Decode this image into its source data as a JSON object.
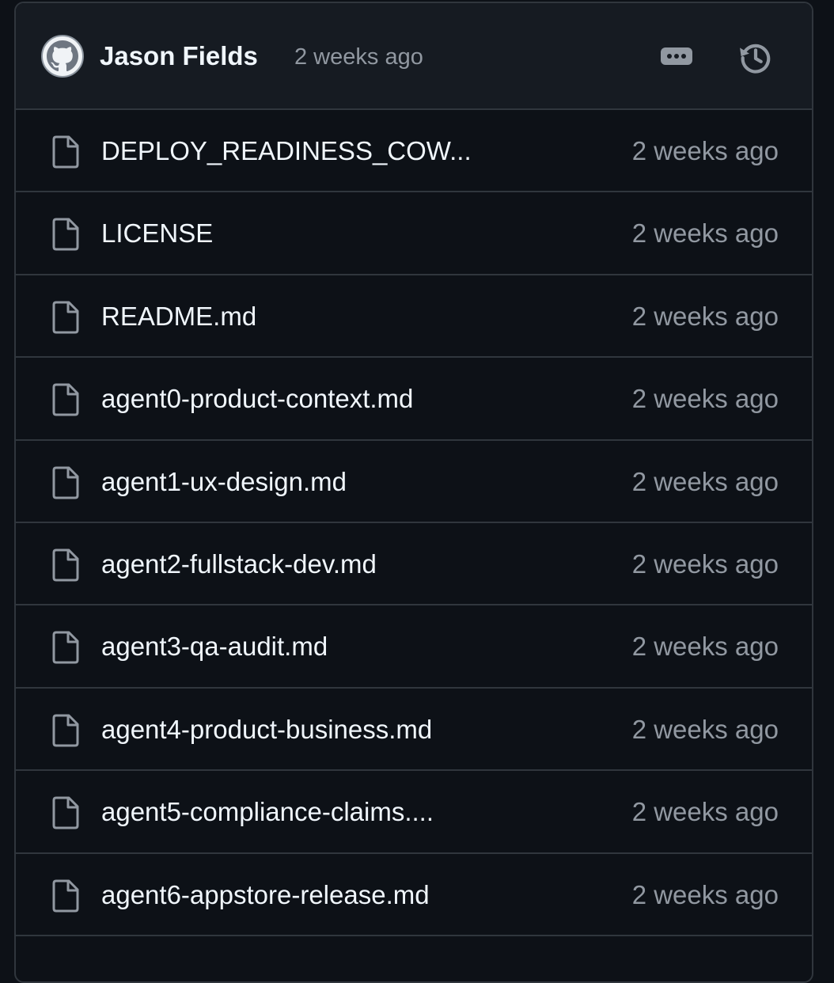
{
  "commit": {
    "author": "Jason Fields",
    "time": "2 weeks ago"
  },
  "icons": {
    "avatar": "github-octocat-icon",
    "more": "kebab-horizontal-icon",
    "history": "history-icon",
    "file": "file-icon"
  },
  "colors": {
    "background": "#0d1117",
    "header": "#161b22",
    "border": "#30363d",
    "text": "#f0f6fc",
    "muted": "#9198a1"
  },
  "files": [
    {
      "name": "DEPLOY_READINESS_COW...",
      "time": "2 weeks ago"
    },
    {
      "name": "LICENSE",
      "time": "2 weeks ago"
    },
    {
      "name": "README.md",
      "time": "2 weeks ago"
    },
    {
      "name": "agent0-product-context.md",
      "time": "2 weeks ago"
    },
    {
      "name": "agent1-ux-design.md",
      "time": "2 weeks ago"
    },
    {
      "name": "agent2-fullstack-dev.md",
      "time": "2 weeks ago"
    },
    {
      "name": "agent3-qa-audit.md",
      "time": "2 weeks ago"
    },
    {
      "name": "agent4-product-business.md",
      "time": "2 weeks ago"
    },
    {
      "name": "agent5-compliance-claims....",
      "time": "2 weeks ago"
    },
    {
      "name": "agent6-appstore-release.md",
      "time": "2 weeks ago"
    }
  ]
}
